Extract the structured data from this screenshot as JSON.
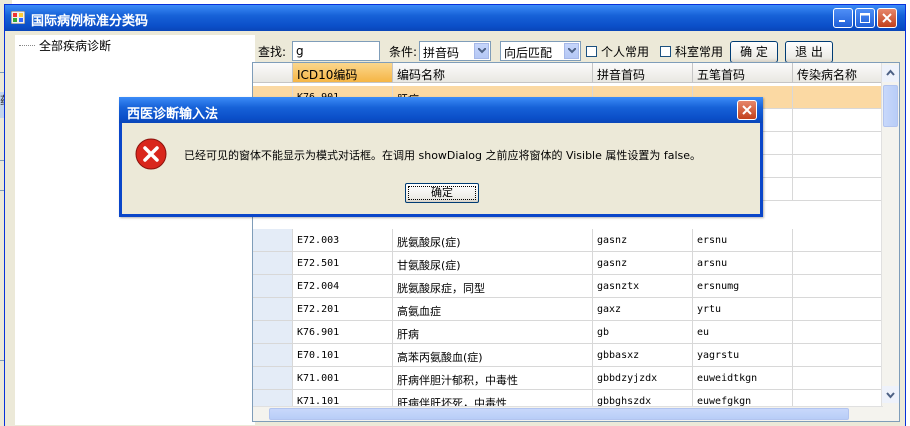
{
  "window": {
    "title": "国际病例标准分类码"
  },
  "background_app": {
    "partial_label": "药"
  },
  "tree": {
    "root_label": "全部疾病诊断"
  },
  "toolbar": {
    "search_label": "查找:",
    "search_value": "g",
    "condition_label": "条件:",
    "condition_value": "拼音码",
    "match_value": "向后匹配",
    "personal_label": "个人常用",
    "dept_label": "科室常用",
    "confirm_label": "确 定",
    "exit_label": "退 出"
  },
  "grid": {
    "columns": [
      "ICD10编码",
      "编码名称",
      "拼音首码",
      "五笔首码",
      "传染病名称"
    ],
    "hidden_top_row": {
      "code": "K76.901",
      "name": "肝病"
    },
    "rows": [
      {
        "code": "E72.003",
        "name": "胱氨酸尿(症)",
        "py": "gasnz",
        "wb": "ersnu",
        "inf": ""
      },
      {
        "code": "E72.501",
        "name": "甘氨酸尿(症)",
        "py": "gasnz",
        "wb": "arsnu",
        "inf": ""
      },
      {
        "code": "E72.004",
        "name": "胱氨酸尿症，同型",
        "py": "gasnztx",
        "wb": "ersnumg",
        "inf": ""
      },
      {
        "code": "E72.201",
        "name": "高氨血症",
        "py": "gaxz",
        "wb": "yrtu",
        "inf": ""
      },
      {
        "code": "K76.901",
        "name": "肝病",
        "py": "gb",
        "wb": "eu",
        "inf": ""
      },
      {
        "code": "E70.101",
        "name": "高苯丙氨酸血(症)",
        "py": "gbbasxz",
        "wb": "yagrstu",
        "inf": ""
      },
      {
        "code": "K71.001",
        "name": "肝病伴胆汁郁积，中毒性",
        "py": "gbbdzyjzdx",
        "wb": "euweidtkgn",
        "inf": ""
      },
      {
        "code": "K71.101",
        "name": "肝病伴肝坏死，中毒性",
        "py": "gbbghszdx",
        "wb": "euwefgkgn",
        "inf": ""
      }
    ]
  },
  "dialog": {
    "title": "西医诊断输入法",
    "message": "已经可见的窗体不能显示为模式对话框。在调用 showDialog 之前应将窗体的 Visible 属性设置为 false。",
    "ok_label": "确定"
  },
  "colors": {
    "titlebar": "#0b4fc9",
    "selected_header": "#f5b545",
    "highlight_row": "#fbd9a3",
    "error_icon": "#d9261c"
  }
}
